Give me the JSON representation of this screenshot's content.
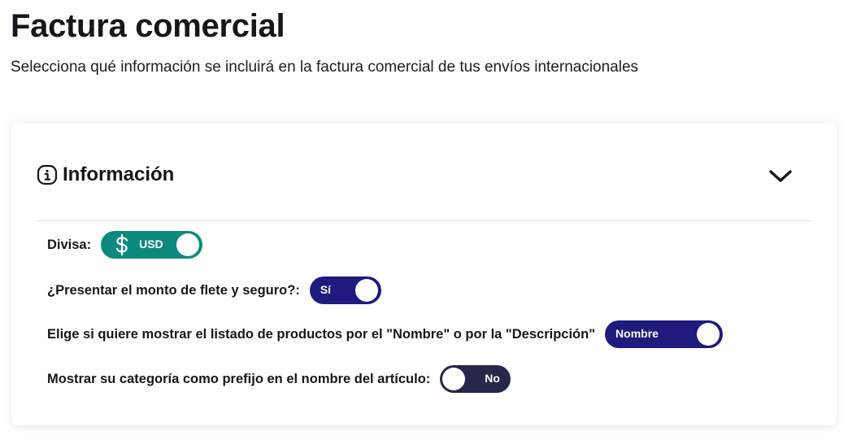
{
  "page": {
    "title": "Factura comercial",
    "subtitle": "Selecciona qué información se incluirá en la factura comercial de tus envíos internacionales"
  },
  "card": {
    "title": "Información",
    "icons": {
      "header": "info-icon",
      "toggle_collapse": "chevron-down-icon"
    },
    "settings": [
      {
        "label": "Divisa:",
        "value": "USD",
        "icon": "dollar-icon",
        "state": "on",
        "color": "#0c8a7d"
      },
      {
        "label": "¿Presentar el monto de flete y seguro?:",
        "value": "Sí",
        "state": "on",
        "color": "#1e1a7e"
      },
      {
        "label": "Elige si quiere mostrar el listado de productos por el \"Nombre\" o por la \"Descripción\"",
        "value": "Nombre",
        "state": "on",
        "color": "#1e1a7e"
      },
      {
        "label": "Mostrar su categoría como prefijo en el nombre del artículo:",
        "value": "No",
        "state": "off",
        "color": "#27274a"
      }
    ]
  }
}
